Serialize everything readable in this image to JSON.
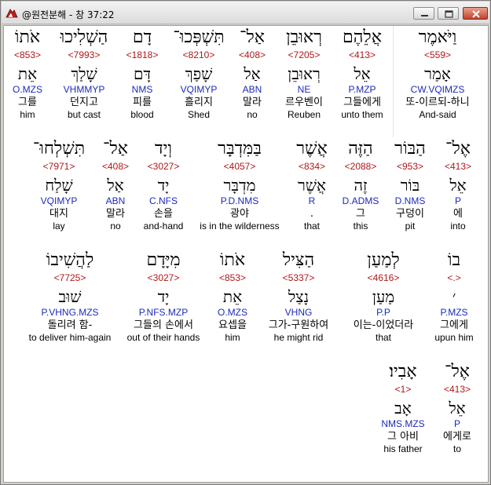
{
  "window": {
    "title": "@원전분해 - 창 37:22",
    "icon": "hebrew-bible-app-icon"
  },
  "rows": [
    {
      "words": [
        {
          "heb": "וַיֹּאמֶר",
          "strong": "<559>",
          "lemma": "אָמַר",
          "parse": "CW.VQIMZS",
          "kor": "또-이르되-하니",
          "eng": "And-said"
        },
        {
          "heb": "אֲלֵהֶם",
          "strong": "<413>",
          "lemma": "אֵל",
          "parse": "P.MZP",
          "kor": "그들에게",
          "eng": "unto them"
        },
        {
          "heb": "רְאוּבֵן",
          "strong": "<7205>",
          "lemma": "רְאוּבֵן",
          "parse": "NE",
          "kor": "르우벤이",
          "eng": "Reuben"
        },
        {
          "heb": "אַל־",
          "strong": "<408>",
          "lemma": "אַל",
          "parse": "ABN",
          "kor": "말라",
          "eng": "no"
        },
        {
          "heb": "תִּשְׁפְּכוּ־",
          "strong": "<8210>",
          "lemma": "שָׁפַךְ",
          "parse": "VQIMYP",
          "kor": "흘리지",
          "eng": "Shed"
        },
        {
          "heb": "דָם",
          "strong": "<1818>",
          "lemma": "דָּם",
          "parse": "NMS",
          "kor": "피를",
          "eng": "blood"
        },
        {
          "heb": "הַשְׁלִיכוּ",
          "strong": "<7993>",
          "lemma": "שָׁלַךְ",
          "parse": "VHMMYP",
          "kor": "던지고",
          "eng": "but cast"
        },
        {
          "heb": "אֹתוֹ",
          "strong": "<853>",
          "lemma": "אֵת",
          "parse": "O.MZS",
          "kor": "그를",
          "eng": "him"
        }
      ]
    },
    {
      "words": [
        {
          "heb": "אֶל־",
          "strong": "<413>",
          "lemma": "אֵל",
          "parse": "P",
          "kor": "에",
          "eng": "into"
        },
        {
          "heb": "הַבּוֹר",
          "strong": "<953>",
          "lemma": "בּוֹר",
          "parse": "D.NMS",
          "kor": "구덩이",
          "eng": "pit"
        },
        {
          "heb": "הַזֶּה",
          "strong": "<2088>",
          "lemma": "זֶה",
          "parse": "D.ADMS",
          "kor": "그",
          "eng": "this"
        },
        {
          "heb": "אֲשֶׁר",
          "strong": "<834>",
          "lemma": "אֲשֶׁר",
          "parse": "R",
          "kor": ".",
          "eng": "that"
        },
        {
          "heb": "בַּמִּדְבָּר",
          "strong": "<4057>",
          "lemma": "מִדְבָּר",
          "parse": "P.D.NMS",
          "kor": "광야",
          "eng": "is in the wilderness"
        },
        {
          "heb": "וְיָד",
          "strong": "<3027>",
          "lemma": "יָד",
          "parse": "C.NFS",
          "kor": "손을",
          "eng": "and-hand"
        },
        {
          "heb": "אַל־",
          "strong": "<408>",
          "lemma": "אַל",
          "parse": "ABN",
          "kor": "말라",
          "eng": "no"
        },
        {
          "heb": "תִּשְׁלְחוּ־",
          "strong": "<7971>",
          "lemma": "שָׁלַח",
          "parse": "VQIMYP",
          "kor": "대지",
          "eng": "lay"
        }
      ]
    },
    {
      "words": [
        {
          "heb": "בוֹ",
          "strong": "<.>",
          "lemma": "׳",
          "parse": "P.MZS",
          "kor": "그에게",
          "eng": "upun him"
        },
        {
          "heb": "לְמַעַן",
          "strong": "<4616>",
          "lemma": "מַעַן",
          "parse": "P.P",
          "kor": "이는-이었더라",
          "eng": "that"
        },
        {
          "heb": "הַצִּיל",
          "strong": "<5337>",
          "lemma": "נָצַל",
          "parse": "VHNG",
          "kor": "그가-구원하여",
          "eng": "he might rid"
        },
        {
          "heb": "אֹתוֹ",
          "strong": "<853>",
          "lemma": "אֵת",
          "parse": "O.MZS",
          "kor": "요셉을",
          "eng": "him"
        },
        {
          "heb": "מִיָּדָם",
          "strong": "<3027>",
          "lemma": "יָד",
          "parse": "P.NFS.MZP",
          "kor": "그들의 손에서",
          "eng": "out of their hands"
        },
        {
          "heb": "לַהֲשִׁיבוֹ",
          "strong": "<7725>",
          "lemma": "שׁוּב",
          "parse": "P.VHNG.MZS",
          "kor": "돌리려 함-",
          "eng": "to deliver him-again"
        }
      ]
    },
    {
      "words": [
        {
          "heb": "אֶל־",
          "strong": "<413>",
          "lemma": "אֵל",
          "parse": "P",
          "kor": "에게로",
          "eng": "to"
        },
        {
          "heb": "אָבִיו׃",
          "strong": "<1>",
          "lemma": "אָב",
          "parse": "NMS.MZS",
          "kor": "그 아비",
          "eng": "his father"
        }
      ]
    }
  ]
}
